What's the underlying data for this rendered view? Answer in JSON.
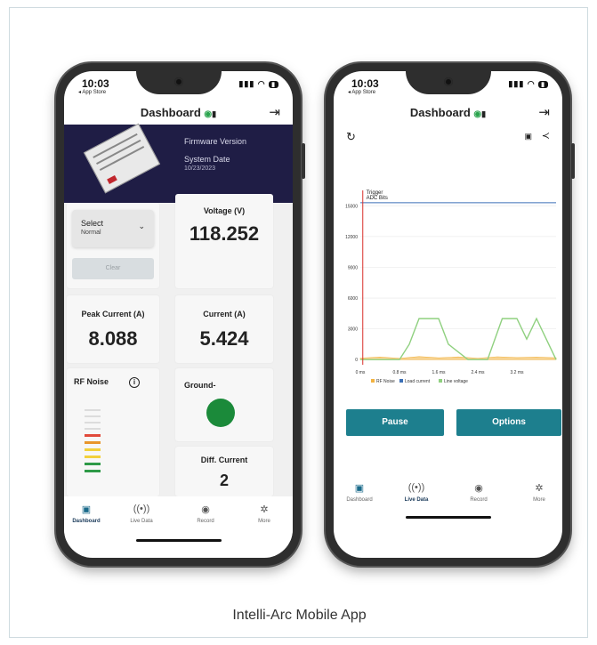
{
  "caption": "Intelli-Arc Mobile App",
  "left_phone": {
    "status": {
      "time": "10:03",
      "back": "◂ App Store"
    },
    "header": {
      "title": "Dashboard"
    },
    "banner": {
      "firmware_label": "Firmware Version",
      "system_date_label": "System Date",
      "system_date_value": "10/23/2023"
    },
    "select": {
      "label": "Select",
      "value": "Normal"
    },
    "clear_label": "Clear",
    "voltage": {
      "label": "Voltage (V)",
      "value": "118.252"
    },
    "peak_current": {
      "label": "Peak Current (A)",
      "value": "8.088"
    },
    "current": {
      "label": "Current (A)",
      "value": "5.424"
    },
    "rf_noise": {
      "label": "RF Noise",
      "levels": [
        "#e14a3b",
        "#e8962b",
        "#f2d13c",
        "#f2d13c",
        "#2e9a47",
        "#2e9a47"
      ]
    },
    "ground": {
      "label": "Ground-",
      "status_color": "#1b8a3a"
    },
    "diff_current": {
      "label": "Diff. Current",
      "value": "2"
    },
    "tabs": [
      "Dashboard",
      "Live Data",
      "Record",
      "More"
    ]
  },
  "right_phone": {
    "status": {
      "time": "10:03",
      "back": "◂ App Store"
    },
    "header": {
      "title": "Dashboard"
    },
    "chart_data": {
      "type": "line",
      "annotations": [
        "Trigger",
        "ADC Bits"
      ],
      "x_ticks": [
        "0 ms",
        "0.8 ms",
        "1.6 ms",
        "2.4 ms",
        "3.2 ms"
      ],
      "y_ticks": [
        "0",
        "3000",
        "6000",
        "9000",
        "12000",
        "15000"
      ],
      "xlim": [
        0,
        4.0
      ],
      "ylim": [
        -500,
        16500
      ],
      "series": [
        {
          "name": "RF Noise",
          "color": "#f2b341",
          "x": [
            0,
            0.4,
            0.8,
            1.2,
            1.6,
            2.0,
            2.4,
            2.8,
            3.2,
            3.6,
            4.0
          ],
          "y": [
            150,
            250,
            120,
            300,
            180,
            260,
            140,
            280,
            200,
            240,
            180
          ]
        },
        {
          "name": "Load current",
          "color": "#3b6fb6",
          "x": [
            0,
            4.0
          ],
          "y": [
            15300,
            15300
          ]
        },
        {
          "name": "Line voltage",
          "color": "#8fd07f",
          "x": [
            0,
            0.8,
            1.0,
            1.2,
            1.6,
            1.8,
            2.2,
            2.6,
            2.9,
            3.2,
            3.4,
            3.6,
            3.8,
            4.0
          ],
          "y": [
            0,
            0,
            1500,
            4000,
            4000,
            1500,
            0,
            0,
            4000,
            4000,
            2000,
            4000,
            2000,
            0
          ]
        },
        {
          "name": "Trigger",
          "color": "#d9302c",
          "x": [
            0.05,
            0.05
          ],
          "y": [
            -500,
            16500
          ]
        }
      ],
      "legend": [
        "RF Noise",
        "Load current",
        "Line voltage"
      ]
    },
    "pause_label": "Pause",
    "options_label": "Options",
    "tabs": [
      "Dashboard",
      "Live Data",
      "Record",
      "More"
    ]
  }
}
